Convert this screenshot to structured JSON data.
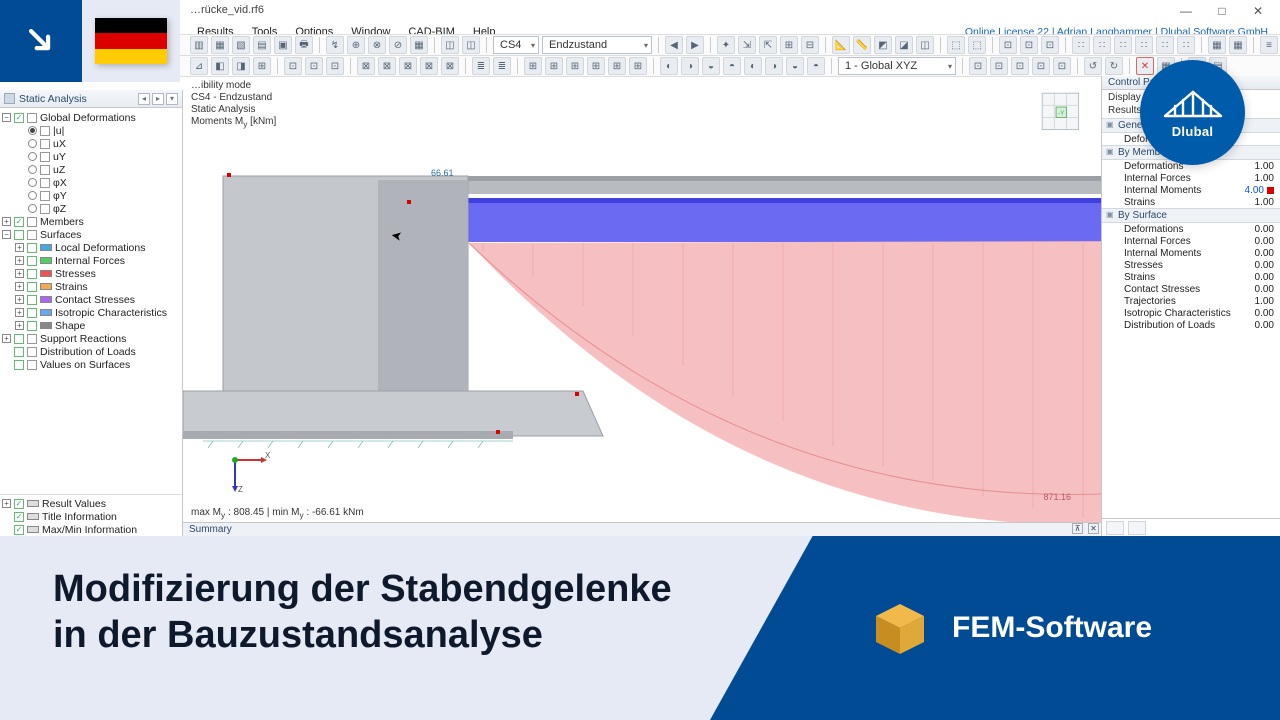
{
  "window": {
    "filename": "…rücke_vid.rf6",
    "license_line": "Online License 22 | Adrian Langhammer | Dlubal Software GmbH",
    "min": "—",
    "max": "□",
    "close": "✕"
  },
  "badges": {
    "dlubal": "Dlubal"
  },
  "menu": {
    "items": [
      "Results",
      "Tools",
      "Options",
      "Window",
      "CAD-BIM",
      "Help"
    ]
  },
  "toolbar": {
    "combo_cs": "CS4",
    "combo_state": "Endzustand",
    "combo_axis": "1 - Global XYZ"
  },
  "navigator": {
    "title": "Static Analysis",
    "global_def": "Global Deformations",
    "def_items": [
      "|u|",
      "uX",
      "uY",
      "uZ",
      "φX",
      "φY",
      "φZ"
    ],
    "members": "Members",
    "surfaces": "Surfaces",
    "surf_items": [
      "Local Deformations",
      "Internal Forces",
      "Stresses",
      "Strains",
      "Contact Stresses",
      "Isotropic Characteristics",
      "Shape"
    ],
    "support": "Support Reactions",
    "distload": "Distribution of Loads",
    "valsurf": "Values on Surfaces",
    "bottom": [
      "Result Values",
      "Title Information",
      "Max/Min Information"
    ]
  },
  "viewport": {
    "info1": "…ibility mode",
    "info2": "CS4 - Endzustand",
    "info3": "Static Analysis",
    "info4_a": "Moments M",
    "info4_b": "y",
    "info4_c": " [kNm]",
    "dim_label": "66.61",
    "far_label": "871.16",
    "footer_a": "max M",
    "footer_b": "y",
    "footer_c": " : 808.45 | min M",
    "footer_d": "y",
    "footer_e": " : -66.61 kNm",
    "summary": "Summary",
    "cube_face": "-Y"
  },
  "control_panel": {
    "title": "Control Panel",
    "sub1": "Display Factors",
    "sub2": "Results",
    "groups": {
      "general": {
        "label": "General",
        "rows": [
          {
            "n": "Deformations",
            "v": ""
          }
        ]
      },
      "by_member": {
        "label": "By Member",
        "rows": [
          {
            "n": "Deformations",
            "v": "1.00"
          },
          {
            "n": "Internal Forces",
            "v": "1.00"
          },
          {
            "n": "Internal Moments",
            "v": "4.00",
            "hl": true
          },
          {
            "n": "Strains",
            "v": "1.00"
          }
        ]
      },
      "by_surface": {
        "label": "By Surface",
        "rows": [
          {
            "n": "Deformations",
            "v": "0.00"
          },
          {
            "n": "Internal Forces",
            "v": "0.00"
          },
          {
            "n": "Internal Moments",
            "v": "0.00"
          },
          {
            "n": "Stresses",
            "v": "0.00"
          },
          {
            "n": "Strains",
            "v": "0.00"
          },
          {
            "n": "Contact Stresses",
            "v": "0.00"
          },
          {
            "n": "Trajectories",
            "v": "1.00"
          },
          {
            "n": "Isotropic Characteristics",
            "v": "0.00"
          },
          {
            "n": "Distribution of Loads",
            "v": "0.00"
          }
        ]
      }
    }
  },
  "overlay": {
    "headline": "Modifizierung der Stabendgelenke in der Bauzustandsanalyse",
    "fem": "FEM-Software"
  }
}
